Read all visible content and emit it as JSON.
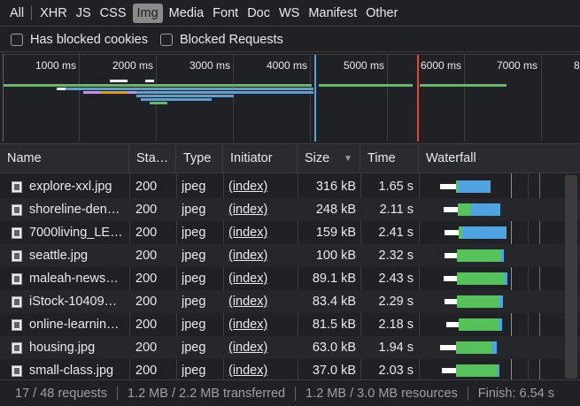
{
  "filters": [
    "All",
    "XHR",
    "JS",
    "CSS",
    "Img",
    "Media",
    "Font",
    "Doc",
    "WS",
    "Manifest",
    "Other"
  ],
  "active_filter": "Img",
  "checkboxes": {
    "blocked_cookies": "Has blocked cookies",
    "blocked_requests": "Blocked Requests"
  },
  "overview": {
    "ticks": [
      "1000 ms",
      "2000 ms",
      "3000 ms",
      "4000 ms",
      "5000 ms",
      "6000 ms",
      "7000 ms",
      "8"
    ]
  },
  "columns": {
    "name": "Name",
    "status": "Sta…",
    "type": "Type",
    "initiator": "Initiator",
    "size": "Size",
    "time": "Time",
    "waterfall": "Waterfall"
  },
  "sort_icon": "sort-descending-icon",
  "rows": [
    {
      "name": "explore-xxl.jpg",
      "status": "200",
      "type": "jpeg",
      "initiator": "(index)",
      "size": "316 kB",
      "time": "1.65 s"
    },
    {
      "name": "shoreline-den…",
      "status": "200",
      "type": "jpeg",
      "initiator": "(index)",
      "size": "248 kB",
      "time": "2.11 s"
    },
    {
      "name": "7000living_LE…",
      "status": "200",
      "type": "jpeg",
      "initiator": "(index)",
      "size": "159 kB",
      "time": "2.41 s"
    },
    {
      "name": "seattle.jpg",
      "status": "200",
      "type": "jpeg",
      "initiator": "(index)",
      "size": "100 kB",
      "time": "2.32 s"
    },
    {
      "name": "maleah-news…",
      "status": "200",
      "type": "jpeg",
      "initiator": "(index)",
      "size": "89.1 kB",
      "time": "2.43 s"
    },
    {
      "name": "iStock-10409…",
      "status": "200",
      "type": "jpeg",
      "initiator": "(index)",
      "size": "83.4 kB",
      "time": "2.29 s"
    },
    {
      "name": "online-learnin…",
      "status": "200",
      "type": "jpeg",
      "initiator": "(index)",
      "size": "81.5 kB",
      "time": "2.18 s"
    },
    {
      "name": "housing.jpg",
      "status": "200",
      "type": "jpeg",
      "initiator": "(index)",
      "size": "63.0 kB",
      "time": "1.94 s"
    },
    {
      "name": "small-class.jpg",
      "status": "200",
      "type": "jpeg",
      "initiator": "(index)",
      "size": "37.0 kB",
      "time": "2.03 s"
    }
  ],
  "status_bar": {
    "requests": "17 / 48 requests",
    "transferred": "1.2 MB / 2.2 MB transferred",
    "resources": "1.2 MB / 3.0 MB resources",
    "finish": "Finish: 6.54 s"
  },
  "colors": {
    "dom_content_loaded": "#4ea3e0",
    "load": "#e0463b",
    "waiting": "#55c35a",
    "download": "#4ea3e0",
    "queued": "#ffffff"
  }
}
